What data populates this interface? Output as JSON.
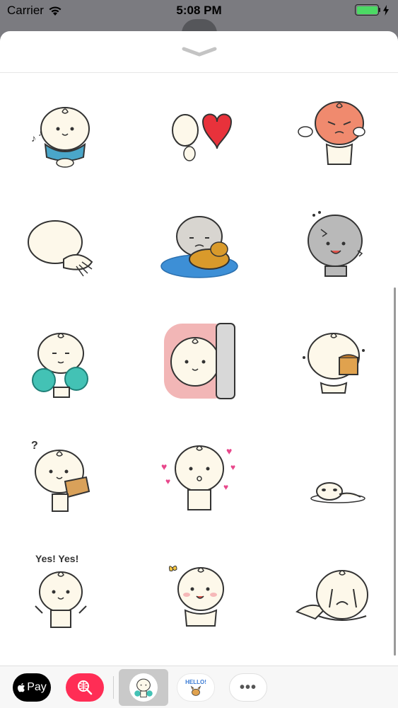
{
  "status_bar": {
    "carrier": "Carrier",
    "time": "5:08 PM",
    "battery_level": 1.0,
    "charging": true,
    "battery_color": "#4cd964"
  },
  "sheet": {
    "grabber_icon": "chevron-down-icon"
  },
  "stickers": [
    {
      "name": "sticker-bear-scarf-music",
      "caption": ""
    },
    {
      "name": "sticker-bear-heart",
      "caption": ""
    },
    {
      "name": "sticker-bear-angry-red",
      "caption": ""
    },
    {
      "name": "sticker-bear-lying-back",
      "caption": ""
    },
    {
      "name": "sticker-bear-float-pond",
      "caption": ""
    },
    {
      "name": "sticker-bear-gray-bruised",
      "caption": ""
    },
    {
      "name": "sticker-bear-pompoms",
      "caption": ""
    },
    {
      "name": "sticker-bear-peek-door",
      "caption": ""
    },
    {
      "name": "sticker-bear-eating-cake",
      "caption": ""
    },
    {
      "name": "sticker-bear-question-box",
      "caption": "?"
    },
    {
      "name": "sticker-bear-kiss-hearts",
      "caption": ""
    },
    {
      "name": "sticker-bear-lying-hole",
      "caption": ""
    },
    {
      "name": "sticker-bear-yes-yes",
      "caption": "Yes! Yes!"
    },
    {
      "name": "sticker-bear-butterfly",
      "caption": ""
    },
    {
      "name": "sticker-bear-crying-lying",
      "caption": ""
    }
  ],
  "app_drawer": {
    "apple_pay_label": "Pay",
    "hello_label": "HELLO!",
    "more_label": "•••",
    "colors": {
      "web_search": "#ff2d55",
      "apple_pay": "#000000"
    }
  }
}
